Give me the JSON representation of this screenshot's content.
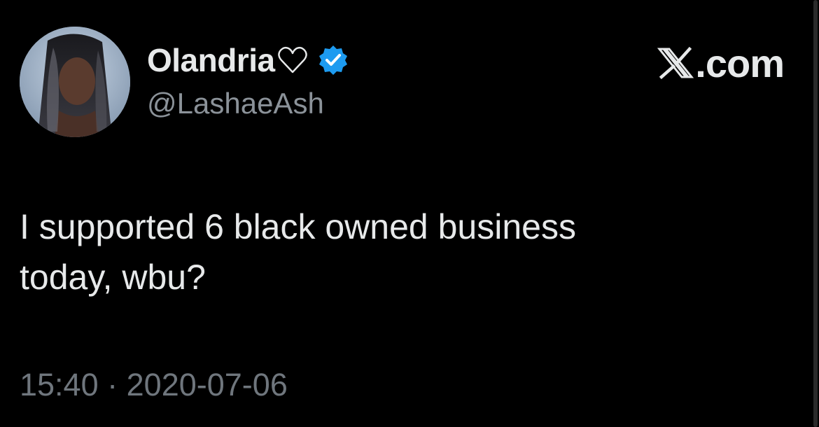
{
  "tweet": {
    "display_name": "Olandria",
    "display_name_heart": "♡",
    "verified": true,
    "handle": "@LashaeAsh",
    "brand_text": ".com",
    "body_line1": "I supported 6 black owned business",
    "body_line2": "today, wbu?",
    "time": "15:40",
    "separator": "·",
    "date": "2020-07-06"
  },
  "icons": {
    "heart": "heart-outline-icon",
    "verified": "verified-badge-icon",
    "brand": "x-logo-icon",
    "avatar": "profile-avatar"
  },
  "colors": {
    "background": "#000000",
    "primary_text": "#e7e9ea",
    "secondary_text": "#8b9299",
    "timestamp_text": "#6f767d",
    "verified_blue": "#1d9bf0"
  }
}
